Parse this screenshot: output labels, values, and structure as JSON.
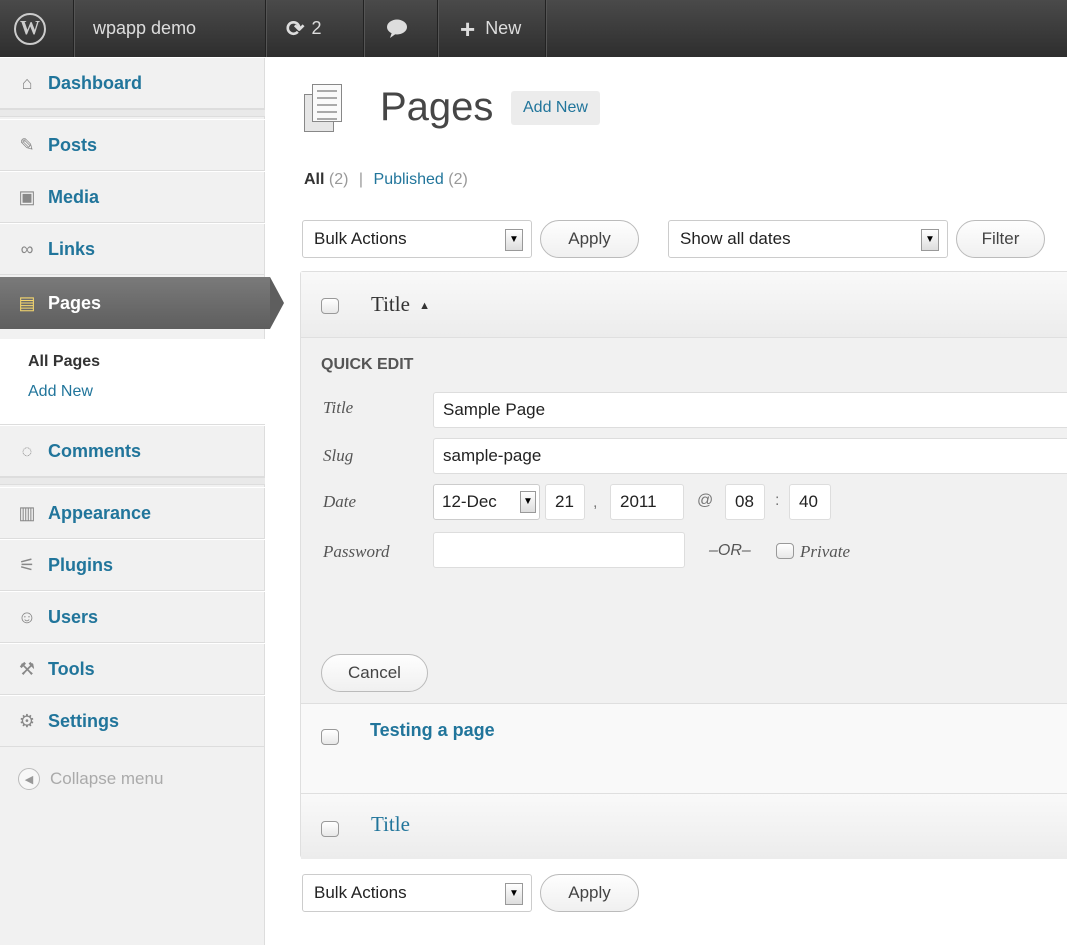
{
  "adminbar": {
    "site_name": "wpapp demo",
    "updates_count": "2",
    "new_label": "New"
  },
  "menu": {
    "dashboard": "Dashboard",
    "posts": "Posts",
    "media": "Media",
    "links": "Links",
    "pages": "Pages",
    "sub_all_pages": "All Pages",
    "sub_add_new": "Add New",
    "comments": "Comments",
    "appearance": "Appearance",
    "plugins": "Plugins",
    "users": "Users",
    "tools": "Tools",
    "settings": "Settings",
    "collapse": "Collapse menu"
  },
  "header": {
    "title": "Pages",
    "add_new": "Add New"
  },
  "filters": {
    "all_label": "All",
    "all_count": "(2)",
    "separator": "|",
    "published_label": "Published",
    "published_count": "(2)"
  },
  "actions": {
    "bulk_actions": "Bulk Actions",
    "apply": "Apply",
    "show_all_dates": "Show all dates",
    "filter": "Filter"
  },
  "table": {
    "column_title": "Title",
    "sort_indicator": "▲",
    "row2_title": "Testing a page",
    "footer_title": "Title"
  },
  "quick_edit": {
    "heading": "QUICK EDIT",
    "title_label": "Title",
    "title_value": "Sample Page",
    "slug_label": "Slug",
    "slug_value": "sample-page",
    "date_label": "Date",
    "month_value": "12-Dec",
    "day_value": "21",
    "year_value": "2011",
    "hour_value": "08",
    "minute_value": "40",
    "comma": ",",
    "at": "@",
    "colon": ":",
    "password_label": "Password",
    "password_value": "",
    "or_text": "–OR–",
    "private_label": "Private",
    "cancel": "Cancel"
  },
  "icons": {
    "wordpress": "wordpress-logo-icon",
    "updates": "refresh-icon",
    "comments": "speech-bubble-icon",
    "new": "plus-icon"
  }
}
